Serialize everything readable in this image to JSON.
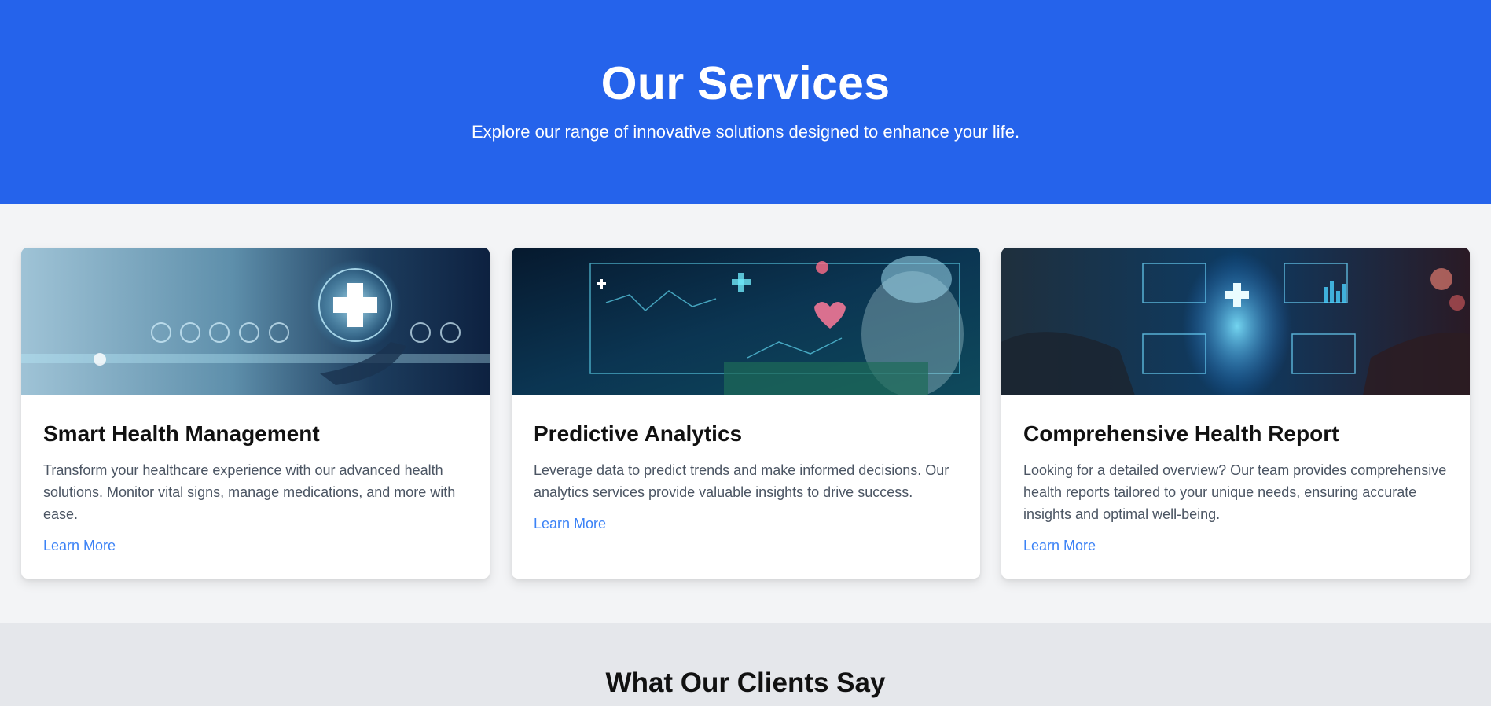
{
  "hero": {
    "title": "Our Services",
    "subtitle": "Explore our range of innovative solutions designed to enhance your life."
  },
  "services": [
    {
      "title": "Smart Health Management",
      "description": "Transform your healthcare experience with our advanced health solutions. Monitor vital signs, manage medications, and more with ease.",
      "link_label": "Learn More",
      "image_icon": "hand-holding-medical-cross-image"
    },
    {
      "title": "Predictive Analytics",
      "description": "Leverage data to predict trends and make informed decisions. Our analytics services provide valuable insights to drive success.",
      "link_label": "Learn More",
      "image_icon": "doctor-with-holographic-dashboard-image"
    },
    {
      "title": "Comprehensive Health Report",
      "description": "Looking for a detailed overview? Our team provides comprehensive health reports tailored to your unique needs, ensuring accurate insights and optimal well-being.",
      "link_label": "Learn More",
      "image_icon": "holographic-body-scan-image"
    }
  ],
  "testimonials": {
    "title": "What Our Clients Say"
  },
  "colors": {
    "hero_bg": "#2563eb",
    "page_bg": "#f3f4f6",
    "testimonials_bg": "#e5e7eb",
    "link": "#3b82f6",
    "body_text": "#4b5563"
  }
}
